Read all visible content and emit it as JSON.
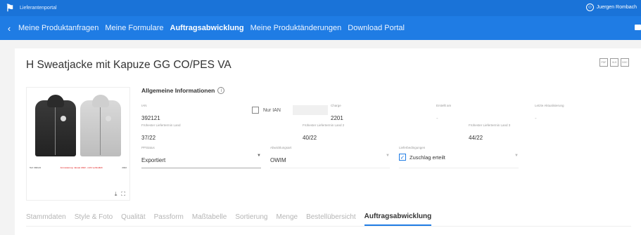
{
  "topbar": {
    "app_title": "Lieferantenportal",
    "user_name": "Juergen Rombach",
    "user_icon": "user-circle-icon"
  },
  "nav": {
    "back_icon": "chevron-left-icon",
    "tabs": [
      {
        "label": "Meine Produktanfragen",
        "active": false
      },
      {
        "label": "Meine Formulare",
        "active": false
      },
      {
        "label": "Auftragsabwicklung",
        "active": true
      },
      {
        "label": "Meine Produktänderungen",
        "active": false
      },
      {
        "label": "Download Portal",
        "active": false
      }
    ]
  },
  "product": {
    "title": "H Sweatjacke mit Kapuze GG CO/PES  VA",
    "doc_icons": [
      "PDF",
      "XLS",
      "DOC"
    ],
    "image_caption_left": "Teil: 392121",
    "image_caption_mid": "Anmusterung: Januar 2022 - nicht verbindlich",
    "image_caption_right": "2022"
  },
  "info": {
    "section_title": "Allgemeine Informationen",
    "ian": {
      "label": "IAN",
      "value": "392121"
    },
    "nur_ian": "Nur IAN",
    "charge": {
      "label": "Charge",
      "value": "2201"
    },
    "erstellt": {
      "label": "Erstellt am",
      "value": "-"
    },
    "aktualisierung": {
      "label": "Letzte Aktualisierung",
      "value": "-"
    },
    "liefertermin_land": {
      "label": "Frühester Liefertermin Land",
      "value": "37/22"
    },
    "liefertermin_land2": {
      "label": "Frühester Liefertermin Land 2",
      "value": "40/22"
    },
    "liefertermin_land3": {
      "label": "Frühester Liefertermin Land 3",
      "value": "44/22"
    },
    "ppstatus": {
      "label": "PPStatus",
      "value": "Exportiert"
    },
    "abwicklungsart": {
      "label": "Abwicklungsart",
      "value": "OWIM"
    },
    "lieferbedingungen": {
      "label": "Lieferbedingungen",
      "value": "-"
    },
    "zuschlag": {
      "label": "Zuschlag erteilt",
      "checked": true
    }
  },
  "detail_tabs": [
    {
      "label": "Stammdaten",
      "active": false
    },
    {
      "label": "Style & Foto",
      "active": false
    },
    {
      "label": "Qualität",
      "active": false
    },
    {
      "label": "Passform",
      "active": false
    },
    {
      "label": "Maßtabelle",
      "active": false
    },
    {
      "label": "Sortierung",
      "active": false
    },
    {
      "label": "Menge",
      "active": false
    },
    {
      "label": "Bestellübersicht",
      "active": false
    },
    {
      "label": "Auftragsabwicklung",
      "active": true
    }
  ]
}
